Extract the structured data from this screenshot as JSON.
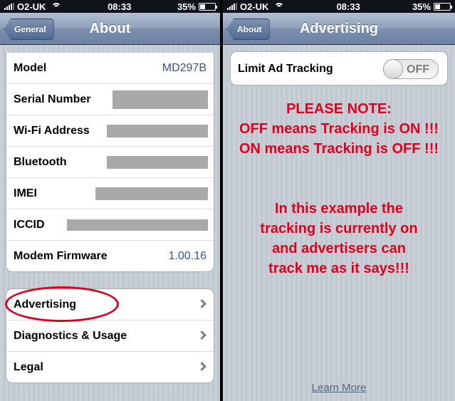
{
  "left": {
    "status": {
      "carrier": "O2-UK",
      "time": "08:33",
      "battery": "35%",
      "battery_level": 0.35
    },
    "nav": {
      "back_label": "General",
      "title": "About"
    },
    "info_rows": [
      {
        "label": "Model",
        "value": "MD297B"
      },
      {
        "label": "Serial Number",
        "value": ""
      },
      {
        "label": "Wi-Fi Address",
        "value": ""
      },
      {
        "label": "Bluetooth",
        "value": ""
      },
      {
        "label": "IMEI",
        "value": ""
      },
      {
        "label": "ICCID",
        "value": ""
      },
      {
        "label": "Modem Firmware",
        "value": "1.00.16"
      }
    ],
    "nav_rows": [
      {
        "label": "Advertising"
      },
      {
        "label": "Diagnostics & Usage"
      },
      {
        "label": "Legal"
      }
    ]
  },
  "right": {
    "status": {
      "carrier": "O2-UK",
      "time": "08:33",
      "battery": "35%",
      "battery_level": 0.35
    },
    "nav": {
      "back_label": "About",
      "title": "Advertising"
    },
    "limit_ad_tracking": {
      "label": "Limit Ad Tracking",
      "state": "OFF"
    },
    "note_lines": [
      "PLEASE NOTE:",
      "OFF means Tracking is ON !!!",
      "ON means Tracking is OFF !!!"
    ],
    "example_lines": [
      "In this example the",
      "tracking is currently on",
      "and advertisers can",
      "track me as it says!!!"
    ],
    "learn_more": "Learn More"
  },
  "colors": {
    "annotation_red": "#e3001b",
    "value_blue": "#385487"
  },
  "icons": [
    "signal-icon",
    "wifi-icon",
    "battery-icon",
    "chevron-right-icon"
  ]
}
